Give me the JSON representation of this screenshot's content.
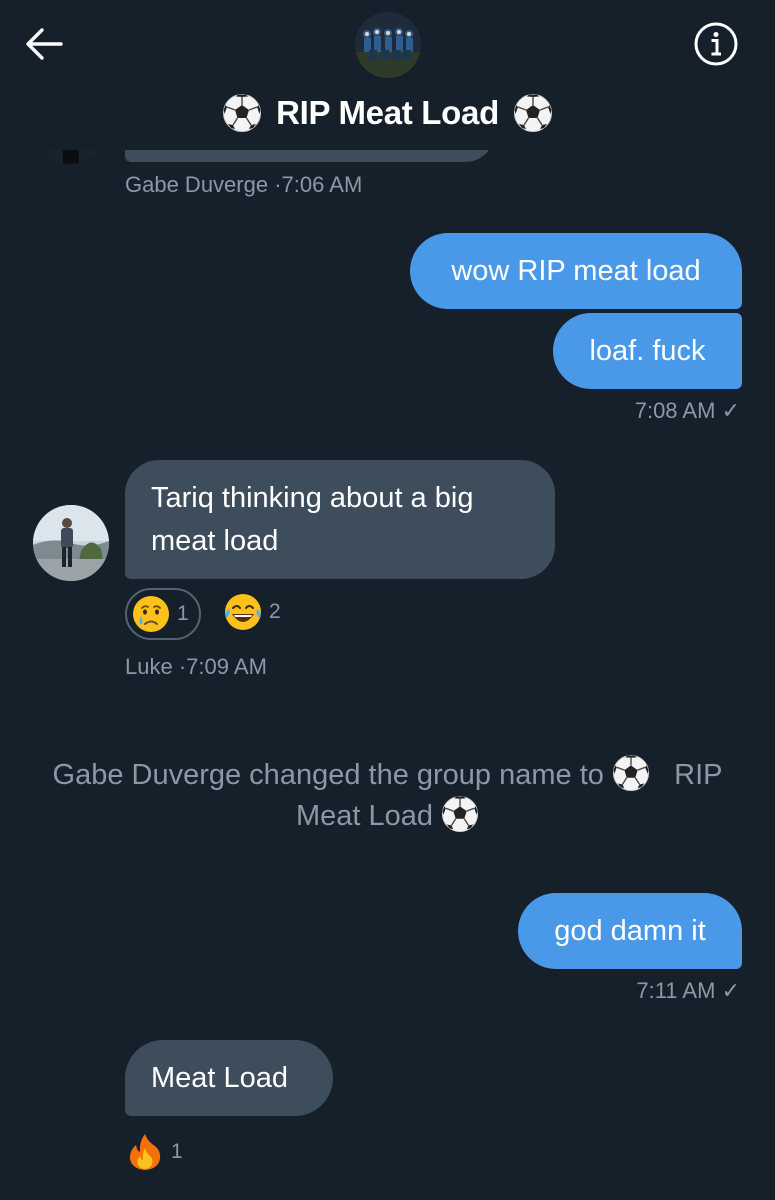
{
  "header": {
    "title": "RIP Meat Load",
    "back_icon": "arrow-left-icon",
    "info_icon": "info-icon"
  },
  "messages": {
    "prev": {
      "sender": "Gabe Duverge",
      "time": "7:06 AM"
    },
    "out1": {
      "lines": [
        "wow RIP meat load",
        "loaf. fuck"
      ],
      "time": "7:08 AM",
      "check": "✓"
    },
    "in1": {
      "text_line1": "Tariq thinking about a big",
      "text_line2": "meat load",
      "sender": "Luke",
      "time": "7:09 AM",
      "reactions": [
        {
          "emoji": "crying-face",
          "count": "1"
        },
        {
          "emoji": "laughing-tears",
          "count": "2"
        }
      ]
    },
    "system": {
      "part1": "Gabe Duverge changed the group name to",
      "part2": "RIP",
      "part3": "Meat Load"
    },
    "out2": {
      "text": "god damn it",
      "time": "7:11 AM",
      "check": "✓"
    },
    "in2": {
      "text": "Meat Load",
      "reactions": [
        {
          "emoji": "fire",
          "count": "1"
        }
      ]
    }
  },
  "colors": {
    "background": "#15202b",
    "bubble_out": "#4a99e9",
    "bubble_in": "#3d4d5c",
    "meta_text": "#8b98a5"
  }
}
